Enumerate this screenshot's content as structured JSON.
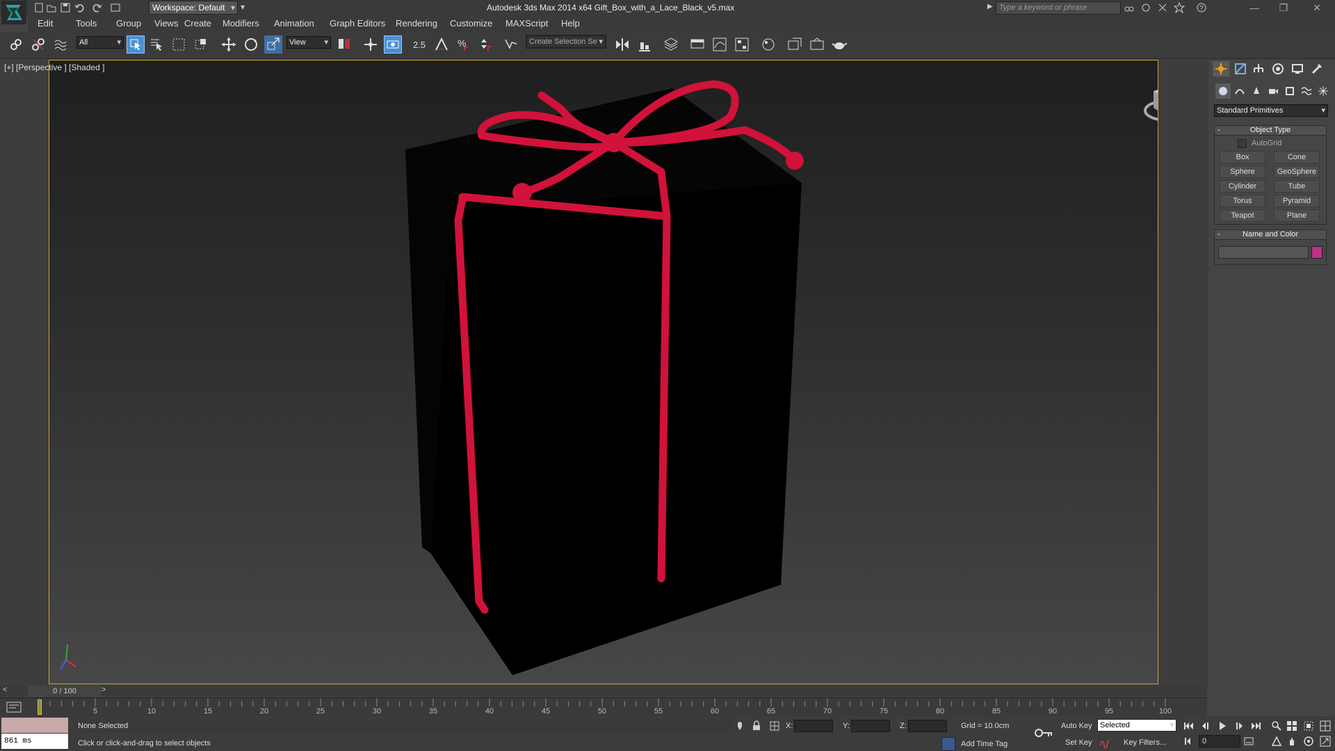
{
  "app": {
    "title": "Autodesk 3ds Max  2014 x64     Gift_Box_with_a_Lace_Black_v5.max",
    "workspace": "Workspace: Default",
    "search_placeholder": "Type a keyword or phrase"
  },
  "menu": [
    "Edit",
    "Tools",
    "Group",
    "Views",
    "Create",
    "Modifiers",
    "Animation",
    "Graph Editors",
    "Rendering",
    "Customize",
    "MAXScript",
    "Help"
  ],
  "toolbar": {
    "selection_filter": "All",
    "ref_coord": "View",
    "snap_label": "2.5",
    "named_selection_placeholder": "Create Selection Se"
  },
  "viewport": {
    "label": "[+] [Perspective ] [Shaded ]",
    "box_color": "#000000",
    "ribbon_color": "#d1123a"
  },
  "command_panel": {
    "category": "Standard Primitives",
    "object_type_title": "Object Type",
    "autogrid": "AutoGrid",
    "buttons": [
      "Box",
      "Cone",
      "Sphere",
      "GeoSphere",
      "Cylinder",
      "Tube",
      "Torus",
      "Pyramid",
      "Teapot",
      "Plane"
    ],
    "name_color_title": "Name and Color",
    "swatch_color": "#c0308a"
  },
  "timeline": {
    "frame_display": "0 / 100",
    "ticks": [
      "5",
      "10",
      "15",
      "20",
      "25",
      "30",
      "35",
      "40",
      "45",
      "50",
      "55",
      "60",
      "65",
      "70",
      "75",
      "80",
      "85",
      "90",
      "95",
      "100"
    ]
  },
  "status": {
    "maxscript_value": "861 ms",
    "selection": "None Selected",
    "prompt": "Click or click-and-drag to select objects",
    "x_label": "X:",
    "y_label": "Y:",
    "z_label": "Z:",
    "grid": "Grid = 10.0cm",
    "add_time_tag": "Add Time Tag",
    "auto_key": "Auto Key",
    "set_key": "Set Key",
    "key_mode": "Selected",
    "key_filters": "Key Filters...",
    "current_frame": "0"
  }
}
